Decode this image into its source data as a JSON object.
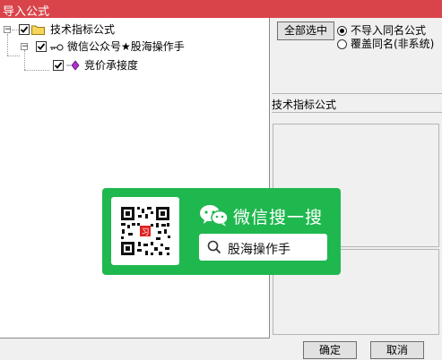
{
  "window": {
    "title": "导入公式"
  },
  "tree": {
    "root": {
      "label": "技术指标公式",
      "checked": true,
      "expander": "−"
    },
    "child": {
      "label": "微信公众号★股海操作手",
      "checked": true,
      "expander": "−"
    },
    "leaf": {
      "label": "竞价承接度",
      "checked": true
    }
  },
  "options": {
    "select_all_label": "全部选中",
    "radio_skip": {
      "label": "不导入同名公式",
      "selected": true
    },
    "radio_overwrite": {
      "label": "覆盖同名(非系统)",
      "selected": false
    }
  },
  "detail": {
    "section_label": "技术指标公式"
  },
  "ad": {
    "title": "微信搜一搜",
    "search_text": "股海操作手",
    "qr_badge_char": "习"
  },
  "footer": {
    "ok_label": "确定",
    "cancel_label": "取消"
  },
  "colors": {
    "titlebar": "#d9444a",
    "ad_green": "#1fb84f",
    "folder": "#f6d55c"
  }
}
